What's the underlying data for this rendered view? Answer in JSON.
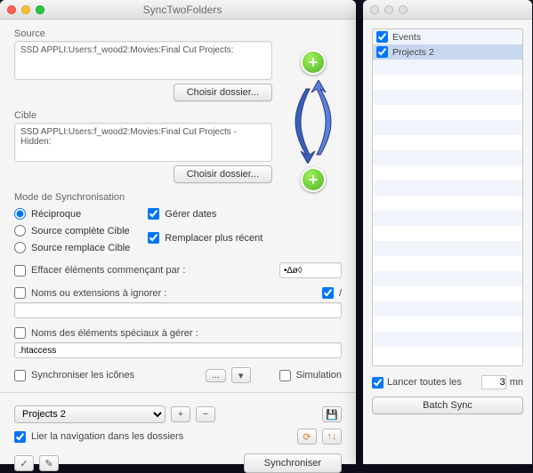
{
  "mainWindow": {
    "title": "SyncTwoFolders"
  },
  "source": {
    "label": "Source",
    "path": "SSD APPLI:Users:f_wood2:Movies:Final Cut Projects:",
    "choose": "Choisir dossier..."
  },
  "target": {
    "label": "Cible",
    "path": "SSD APPLI:Users:f_wood2:Movies:Final Cut Projects - Hidden:",
    "choose": "Choisir dossier..."
  },
  "syncMode": {
    "label": "Mode de Synchronisation",
    "radios": {
      "reciprocal": "Réciproque",
      "sourceComplete": "Source complète Cible",
      "sourceReplace": "Source remplace Cible"
    },
    "handleDates": "Gérer dates",
    "replaceNewer": "Remplacer plus récent"
  },
  "eraseStarting": {
    "label": "Effacer éléments commençant par :",
    "value": "•∆ø◊"
  },
  "ignoreNames": {
    "label": "Noms ou extensions à ignorer :",
    "suffix": "/"
  },
  "specialNames": {
    "label": "Noms des éléments spéciaux à gérer :",
    "value": ".htaccess"
  },
  "syncIcons": "Synchroniser les icônes",
  "simulation": "Simulation",
  "ellipsis": "...",
  "profile": {
    "selected": "Projects 2",
    "linkNav": "Lier la navigation dans les dossiers"
  },
  "syncButton": "Synchroniser",
  "panel": {
    "items": [
      {
        "label": "Events",
        "checked": true,
        "selected": false
      },
      {
        "label": "Projects 2",
        "checked": true,
        "selected": true
      }
    ],
    "launchEvery": "Lancer toutes les",
    "minutes": "3",
    "minutesUnit": "mn",
    "batch": "Batch Sync"
  }
}
